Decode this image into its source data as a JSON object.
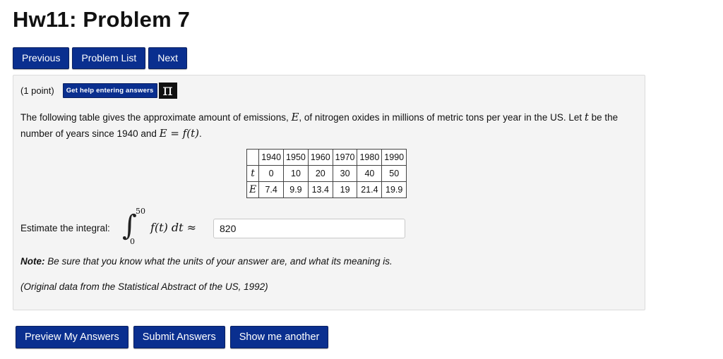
{
  "page": {
    "title": "Hw11: Problem 7"
  },
  "nav": {
    "previous": "Previous",
    "problem_list": "Problem List",
    "next": "Next"
  },
  "problem": {
    "points": "(1 point)",
    "help_button": "Get help entering answers",
    "pi_glyph": "π",
    "statement": {
      "part1": "The following table gives the approximate amount of emissions, ",
      "var_e": "E",
      "part2": ", of nitrogen oxides in millions of metric tons per year in the US. Let ",
      "var_t": "t",
      "part3": " be the number of years since 1940 and ",
      "formula": "E = f(t)",
      "part4": "."
    },
    "table": {
      "years": [
        "1940",
        "1950",
        "1960",
        "1970",
        "1980",
        "1990"
      ],
      "t_label": "t",
      "t_values": [
        "0",
        "10",
        "20",
        "30",
        "40",
        "50"
      ],
      "e_label": "E",
      "e_values": [
        "7.4",
        "9.9",
        "13.4",
        "19",
        "21.4",
        "19.9"
      ]
    },
    "estimate": {
      "label": "Estimate the integral:",
      "upper": "50",
      "lower": "0",
      "integrand": "f(t) dt ≈",
      "answer_value": "820"
    },
    "note_bold": "Note:",
    "note_text": " Be sure that you know what the units of your answer are, and what its meaning is.",
    "source": "(Original data from the Statistical Abstract of the US, 1992)"
  },
  "actions": {
    "preview": "Preview My Answers",
    "submit": "Submit Answers",
    "show_another": "Show me another"
  },
  "colors": {
    "button_bg": "#0a2f8f",
    "panel_bg": "#f4f4f4"
  }
}
